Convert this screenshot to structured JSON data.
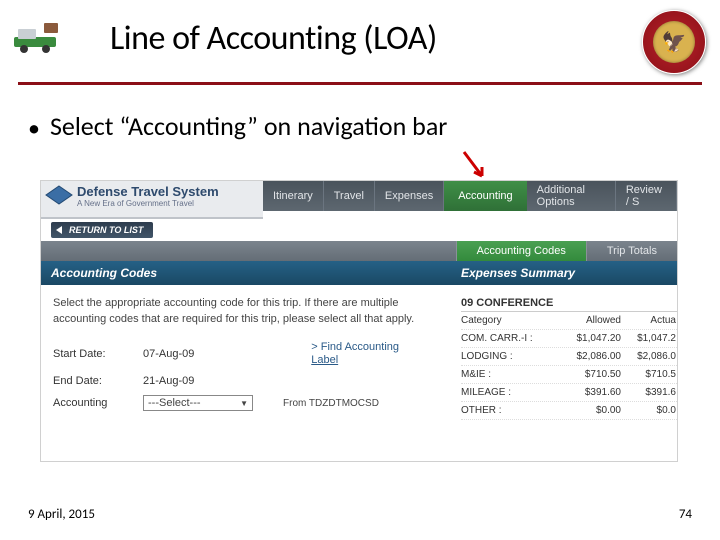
{
  "slide": {
    "title": "Line of Accounting (LOA)",
    "bullet": "Select “Accounting” on navigation bar",
    "footer_date": "9 April, 2015",
    "page_number": "74"
  },
  "dts": {
    "logo_title": "Defense Travel System",
    "logo_sub": "A New Era of Government Travel",
    "nav_tabs": [
      "Itinerary",
      "Travel",
      "Expenses",
      "Accounting",
      "Additional Options",
      "Review / S"
    ],
    "return_btn": "RETURN TO LIST",
    "subnav": [
      "Accounting Codes",
      "Trip Totals"
    ]
  },
  "acct_panel": {
    "heading": "Accounting Codes",
    "instructions": "Select the appropriate accounting code for this trip. If there are multiple accounting codes that are required for this trip, please select all that apply.",
    "start_label": "Start Date:",
    "start_val": "07-Aug-09",
    "end_label": "End Date:",
    "end_val": "21-Aug-09",
    "acct_label": "Accounting",
    "select_placeholder": "---Select---",
    "find_link1": "Find Accounting",
    "find_link2": "Label",
    "from_text": "From TDZDTMOCSD"
  },
  "expenses": {
    "heading": "Expenses Summary",
    "trip": "09 CONFERENCE",
    "cols": [
      "Category",
      "Allowed",
      "Actua"
    ],
    "rows": [
      {
        "c": "COM. CARR.-I :",
        "a": "$1,047.20",
        "x": "$1,047.2"
      },
      {
        "c": "LODGING :",
        "a": "$2,086.00",
        "x": "$2,086.0"
      },
      {
        "c": "M&IE :",
        "a": "$710.50",
        "x": "$710.5"
      },
      {
        "c": "MILEAGE :",
        "a": "$391.60",
        "x": "$391.6"
      },
      {
        "c": "OTHER :",
        "a": "$0.00",
        "x": "$0.0"
      }
    ]
  }
}
